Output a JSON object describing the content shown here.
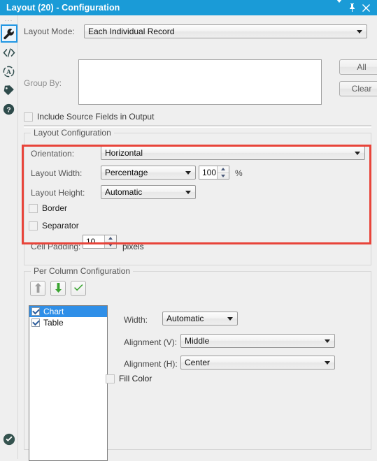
{
  "window": {
    "title": "Layout (20) - Configuration",
    "titlebar_icons": [
      "chevron-down-icon",
      "pin-icon",
      "close-icon"
    ],
    "accent_color": "#1a9bd7",
    "highlight_color": "#e8443a"
  },
  "rail": {
    "grip": "···",
    "items": [
      {
        "name": "wrench-icon",
        "selected": true
      },
      {
        "name": "code-icon",
        "selected": false
      },
      {
        "name": "annotation-icon",
        "selected": false
      },
      {
        "name": "tag-icon",
        "selected": false
      },
      {
        "name": "help-icon",
        "selected": false
      }
    ],
    "bottom": {
      "name": "check-circle-icon"
    }
  },
  "layout_mode": {
    "label": "Layout Mode:",
    "value": "Each Individual Record"
  },
  "group_by": {
    "label": "Group By:",
    "enabled": false,
    "items": [],
    "buttons": {
      "all": "All",
      "clear": "Clear"
    }
  },
  "include_source_fields": {
    "label": "Include Source Fields in Output",
    "checked": false,
    "enabled": false
  },
  "layout_configuration": {
    "title": "Layout Configuration",
    "orientation": {
      "label": "Orientation:",
      "value": "Horizontal"
    },
    "layout_width": {
      "label": "Layout Width:",
      "value": "Percentage",
      "amount": "100",
      "unit": "%"
    },
    "layout_height": {
      "label": "Layout Height:",
      "value": "Automatic"
    },
    "border": {
      "label": "Border",
      "checked": false
    },
    "separator": {
      "label": "Separator",
      "checked": false
    },
    "cell_padding": {
      "label": "Cell Padding:",
      "amount": "10",
      "unit": "pixels"
    }
  },
  "per_column_configuration": {
    "title": "Per Column Configuration",
    "toolbar": [
      {
        "name": "move-up-button",
        "glyph": "up-arrow-icon",
        "enabled": false
      },
      {
        "name": "move-down-button",
        "glyph": "down-arrow-icon",
        "enabled": true
      },
      {
        "name": "check-all-button",
        "glyph": "checkmark-icon",
        "enabled": true
      }
    ],
    "columns": [
      {
        "label": "Chart",
        "checked": true,
        "selected": true
      },
      {
        "label": "Table",
        "checked": true,
        "selected": false
      }
    ],
    "width": {
      "label": "Width:",
      "value": "Automatic"
    },
    "alignment_v": {
      "label": "Alignment (V):",
      "value": "Middle"
    },
    "alignment_h": {
      "label": "Alignment (H):",
      "value": "Center"
    },
    "fill_color": {
      "label": "Fill Color",
      "checked": false
    }
  }
}
